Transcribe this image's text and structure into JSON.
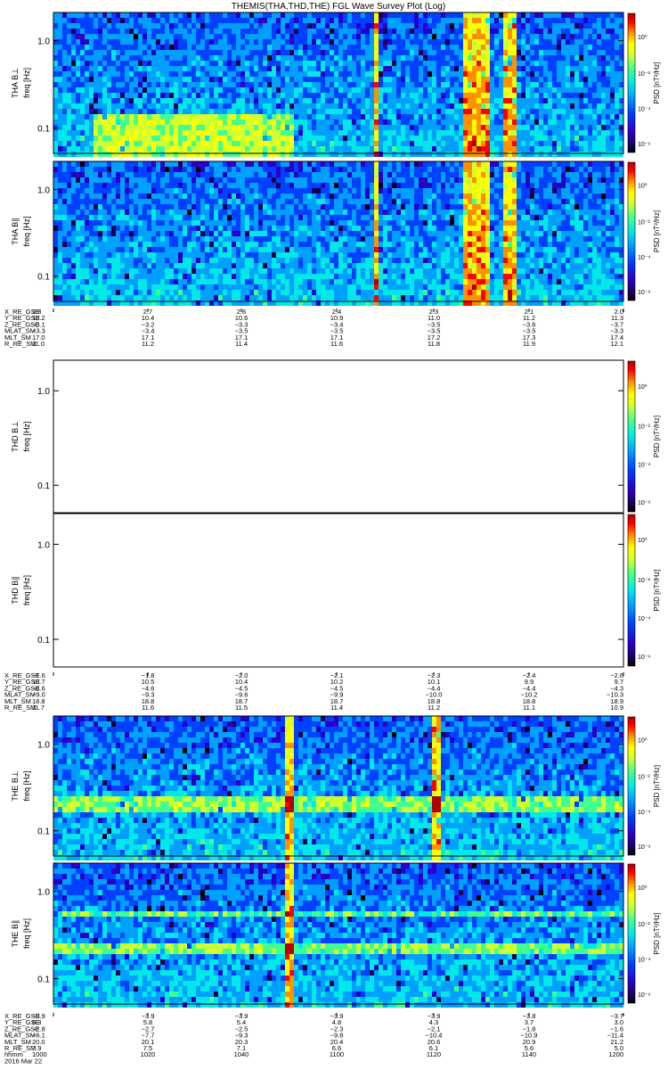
{
  "title": "THEMIS(THA,THD,THE) FGL Wave Survey Plot (Log)",
  "colorbar": {
    "label": "PSD [nT²/Hz]",
    "ticks": [
      "10⁰",
      "10⁻²",
      "10⁻⁴",
      "10⁻⁶"
    ],
    "colors": [
      "#000000",
      "#1a0050",
      "#2a00c8",
      "#0040ff",
      "#00a0ff",
      "#00e8e8",
      "#40ff90",
      "#d0ff30",
      "#ffff00",
      "#ff9000",
      "#ff0000",
      "#b00000"
    ]
  },
  "chart_data": [
    {
      "type": "heatmap",
      "probe": "THA",
      "component": "B⊥",
      "ylabel_probe": "THA B⊥",
      "ylabel_unit": "freq [Hz]",
      "yscale": "log",
      "ytick_labels": [
        "1.0",
        "0.1"
      ],
      "has_data": true,
      "bright_bands_x": [
        0.562,
        0.72,
        0.728,
        0.738,
        0.748,
        0.754,
        0.792,
        0.8
      ],
      "low_freq_enhancement": [
        0.07,
        0.42
      ]
    },
    {
      "type": "heatmap",
      "probe": "THA",
      "component": "B∥",
      "ylabel_probe": "THA B∥",
      "ylabel_unit": "freq [Hz]",
      "yscale": "log",
      "ytick_labels": [
        "1.0",
        "0.1"
      ],
      "has_data": true,
      "bright_bands_x": [
        0.562,
        0.72,
        0.728,
        0.738,
        0.748,
        0.754,
        0.792,
        0.8
      ]
    },
    {
      "type": "heatmap",
      "probe": "THD",
      "component": "B⊥",
      "ylabel_probe": "THD B⊥",
      "ylabel_unit": "freq [Hz]",
      "yscale": "log",
      "ytick_labels": [
        "1.0",
        "0.1"
      ],
      "has_data": false
    },
    {
      "type": "heatmap",
      "probe": "THD",
      "component": "B∥",
      "ylabel_probe": "THD B∥",
      "ylabel_unit": "freq [Hz]",
      "yscale": "log",
      "ytick_labels": [
        "1.0",
        "0.1"
      ],
      "has_data": false
    },
    {
      "type": "heatmap",
      "probe": "THE",
      "component": "B⊥",
      "ylabel_probe": "THE B⊥",
      "ylabel_unit": "freq [Hz]",
      "yscale": "log",
      "ytick_labels": [
        "1.0",
        "0.1"
      ],
      "has_data": true,
      "bright_bands_x": [
        0.41,
        0.67
      ],
      "horizontal_band_y": [
        0.55,
        0.6
      ]
    },
    {
      "type": "heatmap",
      "probe": "THE",
      "component": "B∥",
      "ylabel_probe": "THE B∥",
      "ylabel_unit": "freq [Hz]",
      "yscale": "log",
      "ytick_labels": [
        "1.0",
        "0.1"
      ],
      "has_data": true,
      "bright_bands_x": [
        0.41
      ],
      "horizontal_band_y": [
        0.34,
        0.58
      ]
    }
  ],
  "ephemeris": [
    {
      "probe": "THA",
      "labels": [
        "X_RE_GSE",
        "Y_RE_GSE",
        "Z_RE_GSE",
        "MLAT_SM",
        "MLT_SM",
        "R_RE_SM"
      ],
      "rows": [
        [
          "2.8",
          "2.7",
          "2.6",
          "2.4",
          "2.3",
          "2.1",
          "2.0"
        ],
        [
          "10.2",
          "10.4",
          "10.6",
          "10.9",
          "11.0",
          "11.2",
          "11.3"
        ],
        [
          "−3.1",
          "−3.2",
          "−3.3",
          "−3.4",
          "−3.5",
          "−3.6",
          "−3.7"
        ],
        [
          "−3.3",
          "−3.4",
          "−3.5",
          "−3.5",
          "−3.5",
          "−3.5",
          "−3.3"
        ],
        [
          "17.0",
          "17.1",
          "17.1",
          "17.1",
          "17.2",
          "17.3",
          "17.4"
        ],
        [
          "11.0",
          "11.2",
          "11.4",
          "11.6",
          "11.8",
          "11.9",
          "12.1"
        ]
      ]
    },
    {
      "probe": "THD",
      "labels": [
        "X_RE_GSE",
        "Y_RE_GSE",
        "Z_RE_GSE",
        "MLAT_SM",
        "MLT_SM",
        "R_RE_SM"
      ],
      "rows": [
        [
          "−1.6",
          "−1.8",
          "−2.0",
          "−2.1",
          "−2.3",
          "−2.4",
          "−2.6"
        ],
        [
          "10.7",
          "10.5",
          "10.4",
          "10.2",
          "10.1",
          "9.9",
          "9.7"
        ],
        [
          "−4.6",
          "−4.6",
          "−4.5",
          "−4.5",
          "−4.4",
          "−4.4",
          "−4.3"
        ],
        [
          "−9.0",
          "−9.3",
          "−9.6",
          "−9.9",
          "−10.0",
          "−10.2",
          "−10.3"
        ],
        [
          "18.8",
          "18.8",
          "18.7",
          "18.7",
          "18.8",
          "18.8",
          "18.9"
        ],
        [
          "11.7",
          "11.6",
          "11.5",
          "11.4",
          "11.2",
          "11.1",
          "10.9"
        ]
      ]
    },
    {
      "probe": "THE",
      "labels": [
        "X_RE_GSE",
        "Y_RE_GSE",
        "Z_RE_GSE",
        "MLAT_SM",
        "MLT_SM",
        "R_RE_SM",
        "hhmm",
        "2016 Mar 22"
      ],
      "rows": [
        [
          "−3.9",
          "−3.9",
          "−3.9",
          "−3.9",
          "−3.9",
          "−3.8",
          "−3.7"
        ],
        [
          "6.3",
          "5.8",
          "5.4",
          "4.8",
          "4.3",
          "3.7",
          "3.0"
        ],
        [
          "−2.8",
          "−2.7",
          "−2.5",
          "−2.3",
          "−2.1",
          "−1.8",
          "−1.6"
        ],
        [
          "−6.1",
          "−7.7",
          "−9.3",
          "−9.8",
          "−10.4",
          "−10.9",
          "−11.4"
        ],
        [
          "20.0",
          "20.1",
          "20.3",
          "20.4",
          "20.6",
          "20.9",
          "21.2"
        ],
        [
          "7.9",
          "7.5",
          "7.1",
          "6.6",
          "6.1",
          "5.6",
          "5.0"
        ],
        [
          "1000",
          "1020",
          "1040",
          "1100",
          "1120",
          "1140",
          "1200"
        ]
      ]
    }
  ]
}
